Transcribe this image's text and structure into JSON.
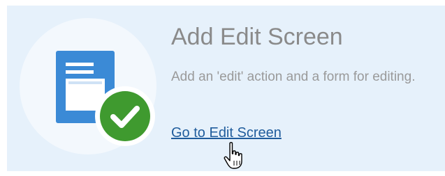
{
  "card": {
    "title": "Add Edit Screen",
    "description": "Add an 'edit' action and a form for editing.",
    "link_label": "Go to Edit Screen"
  },
  "icons": {
    "document": "document-icon",
    "badge": "checkmark-icon",
    "cursor": "hand-pointer-cursor"
  },
  "colors": {
    "card_background": "#e6f1fb",
    "document_blue": "#3b8ad6",
    "check_green": "#3f9a2f",
    "link": "#1f5c9c",
    "title_text": "#8a8a8a"
  }
}
